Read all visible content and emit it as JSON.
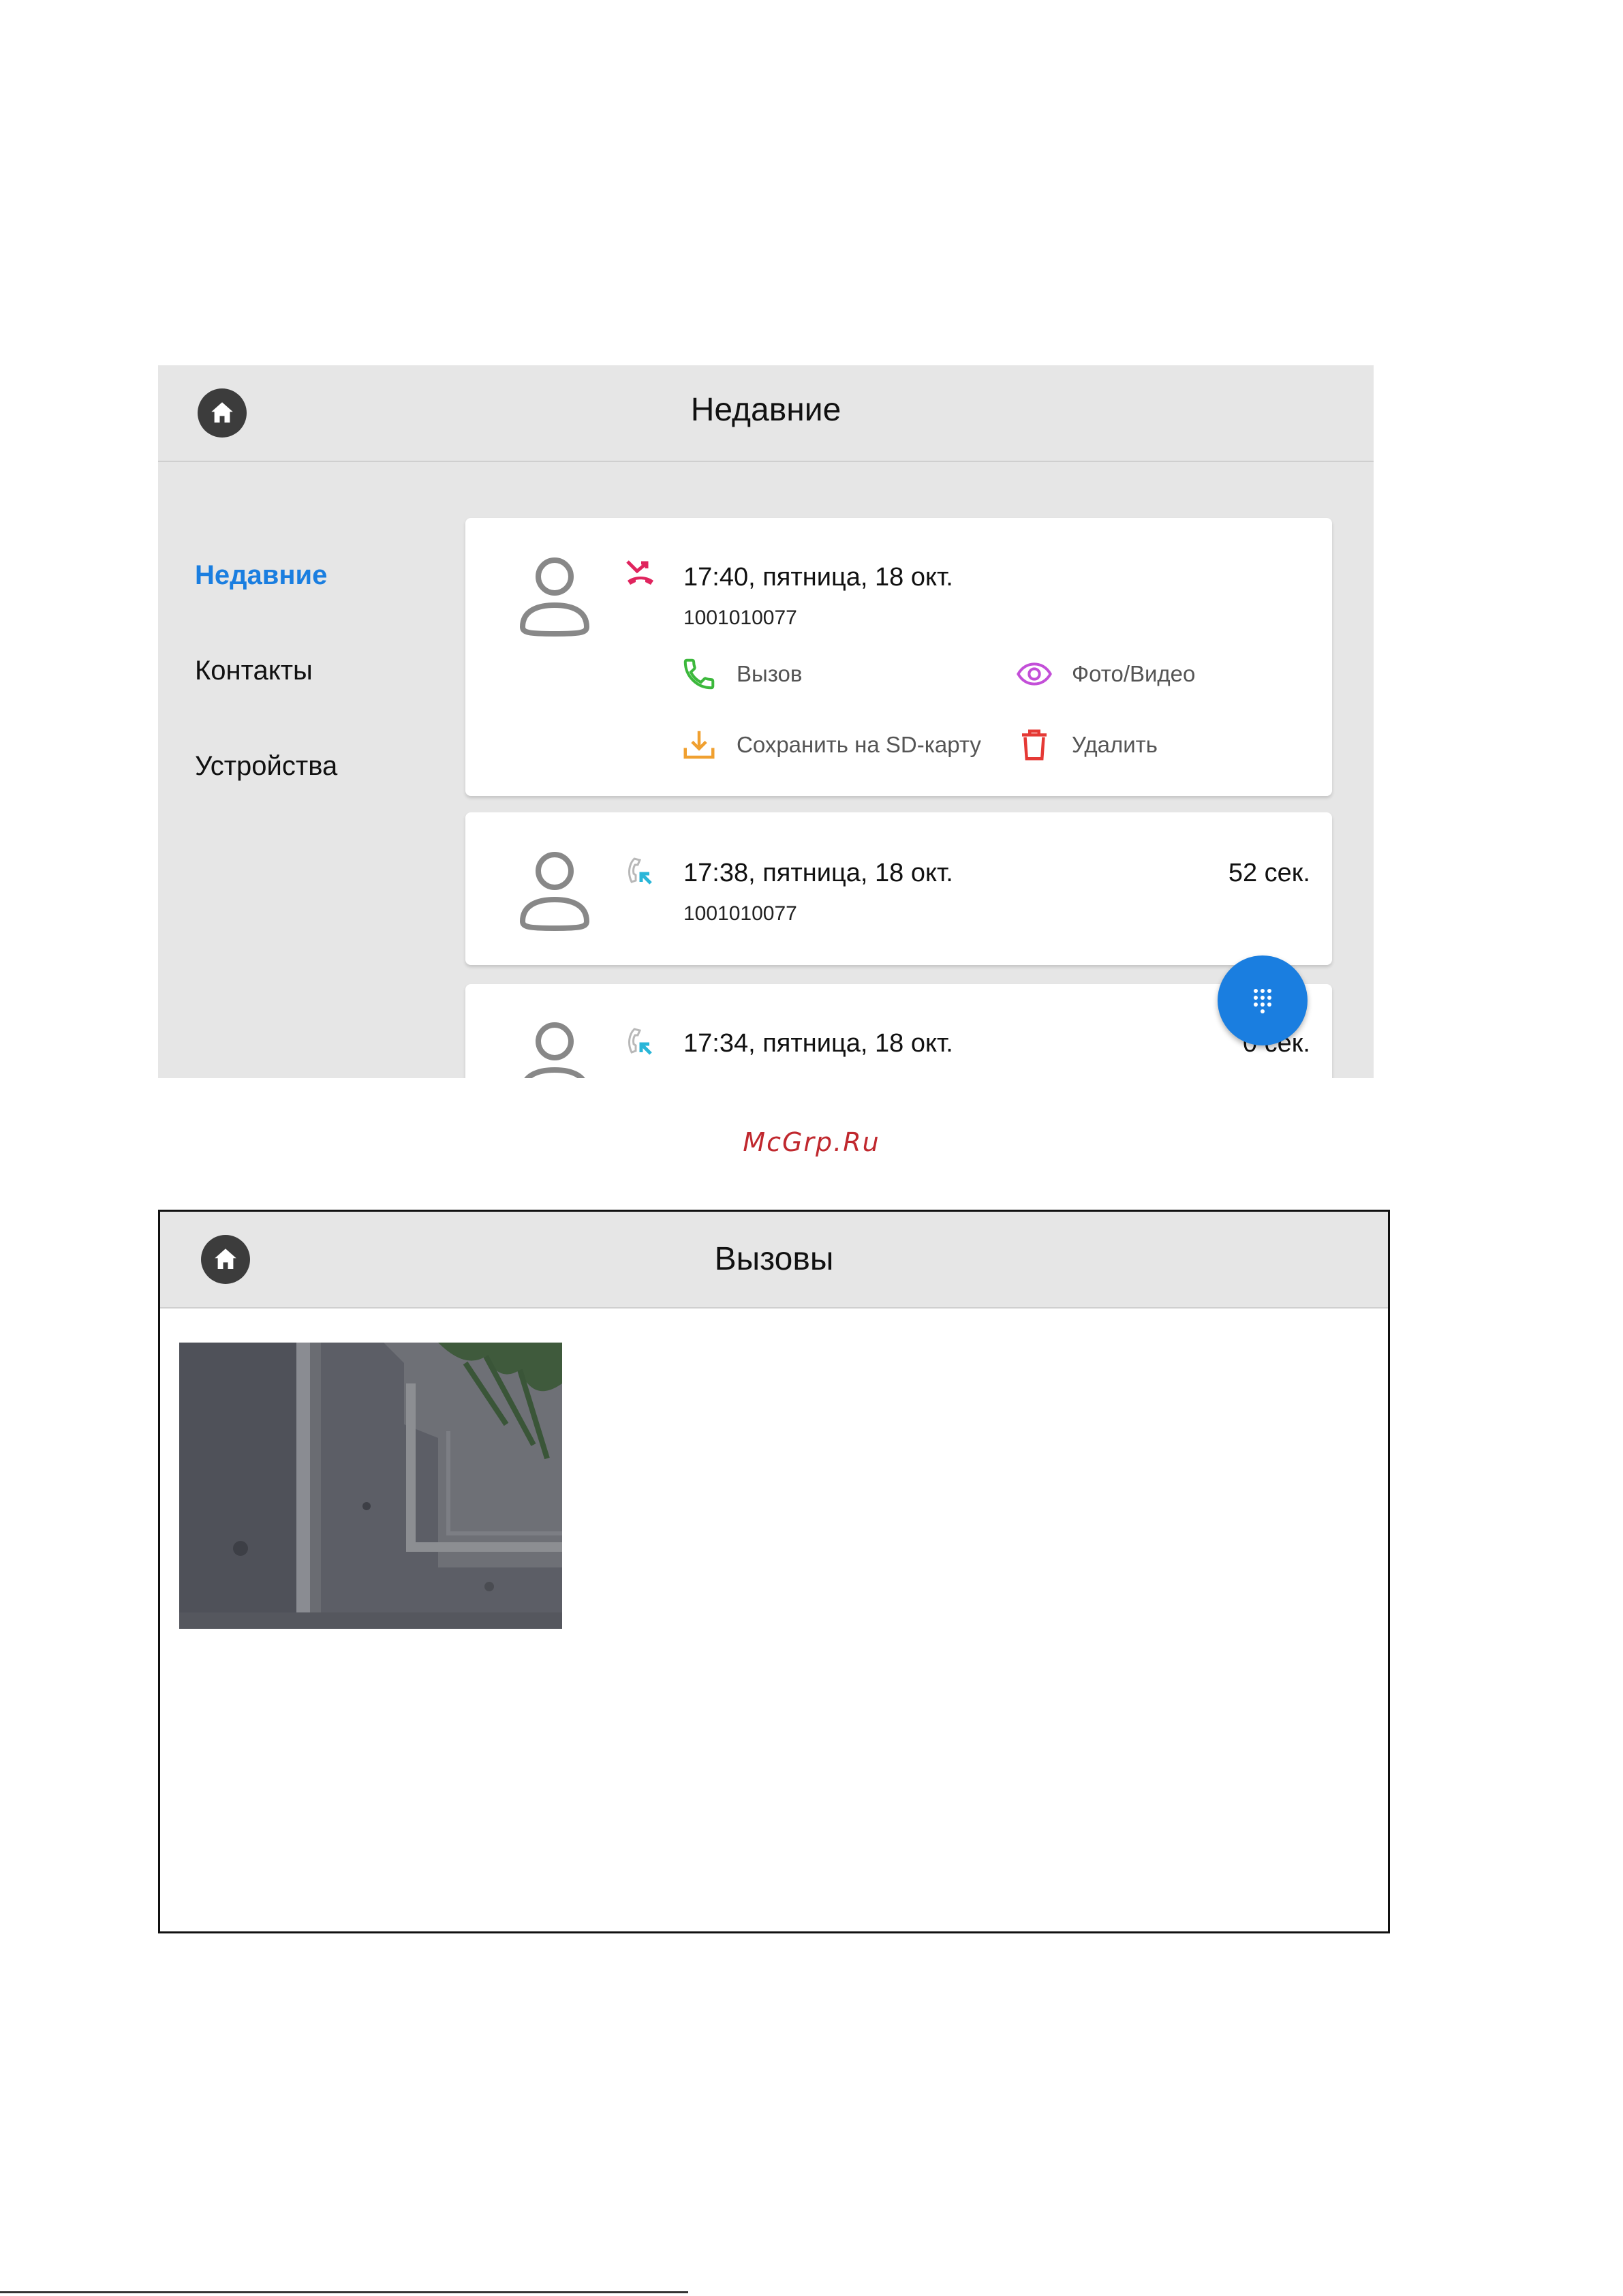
{
  "screen1": {
    "title": "Недавние",
    "sidebar": [
      {
        "label": "Недавние",
        "active": true
      },
      {
        "label": "Контакты",
        "active": false
      },
      {
        "label": "Устройства",
        "active": false
      }
    ],
    "calls": [
      {
        "type": "missed",
        "time": "17:40, пятница, 18 окт.",
        "number": "1001010077",
        "duration": "",
        "actions": {
          "call": "Вызов",
          "photo_video": "Фото/Видео",
          "save": "Сохранить на SD-карту",
          "delete": "Удалить"
        }
      },
      {
        "type": "incoming",
        "time": "17:38, пятница, 18 окт.",
        "number": "1001010077",
        "duration": "52 сек."
      },
      {
        "type": "incoming",
        "time": "17:34, пятница, 18 окт.",
        "duration": "0 сек."
      }
    ]
  },
  "watermark": "McGrp.Ru",
  "screen2": {
    "title": "Вызовы"
  },
  "colors": {
    "accent": "#1a7ee0",
    "missed": "#e0245e",
    "incoming": "#29b6d8",
    "call_action": "#3cb83c",
    "photo_action": "#c34fd8",
    "save_action": "#f0a030",
    "delete_action": "#e53935",
    "header_bg": "#e6e6e6",
    "watermark": "#c0282e"
  }
}
